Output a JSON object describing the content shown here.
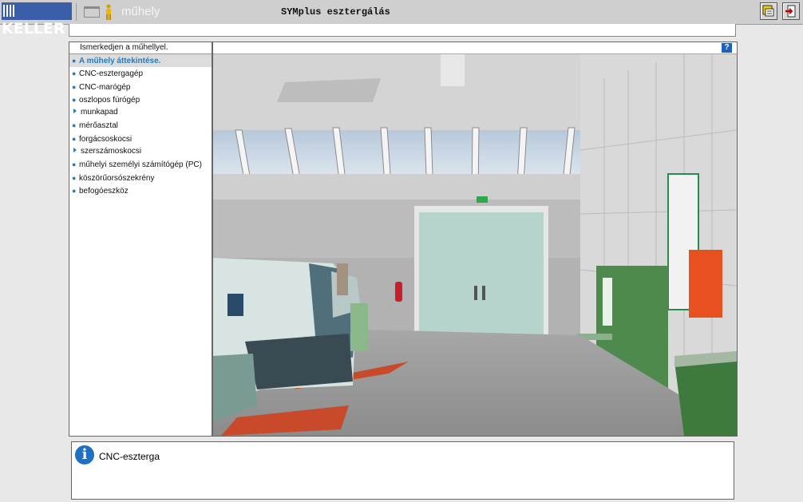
{
  "toolbar": {
    "logo_text": "KELLER",
    "module_name": "műhely",
    "app_title": "SYMplus esztergálás",
    "buttons": [
      {
        "name": "tools-button",
        "icon": "tools-icon"
      },
      {
        "name": "exit-button",
        "icon": "exit-door-icon"
      }
    ]
  },
  "nav": {
    "header": "Ismerkedjen a műhellyel.",
    "items": [
      {
        "label": "A műhely áttekintése.",
        "marker": "bullet",
        "active": true
      },
      {
        "label": "CNC-esztergagép",
        "marker": "bullet"
      },
      {
        "label": "CNC-marógép",
        "marker": "bullet"
      },
      {
        "label": "oszlopos fúrógép",
        "marker": "bullet"
      },
      {
        "label": "munkapad",
        "marker": "triangle"
      },
      {
        "label": "mérőasztal",
        "marker": "bullet"
      },
      {
        "label": "forgácsoskocsi",
        "marker": "bullet"
      },
      {
        "label": "szerszámoskocsi",
        "marker": "triangle"
      },
      {
        "label": "műhelyi személyi számítógép (PC)",
        "marker": "bullet"
      },
      {
        "label": "köszörűorsószekrény",
        "marker": "bullet"
      },
      {
        "label": "befogóeszköz",
        "marker": "bullet"
      }
    ]
  },
  "viewer": {
    "help_label": "?",
    "scene": "3d-workshop-view"
  },
  "info": {
    "icon": "info-icon",
    "text": "CNC-esztergа"
  },
  "colors": {
    "accent": "#2a7ab8",
    "brand": "#3a5fa8"
  }
}
